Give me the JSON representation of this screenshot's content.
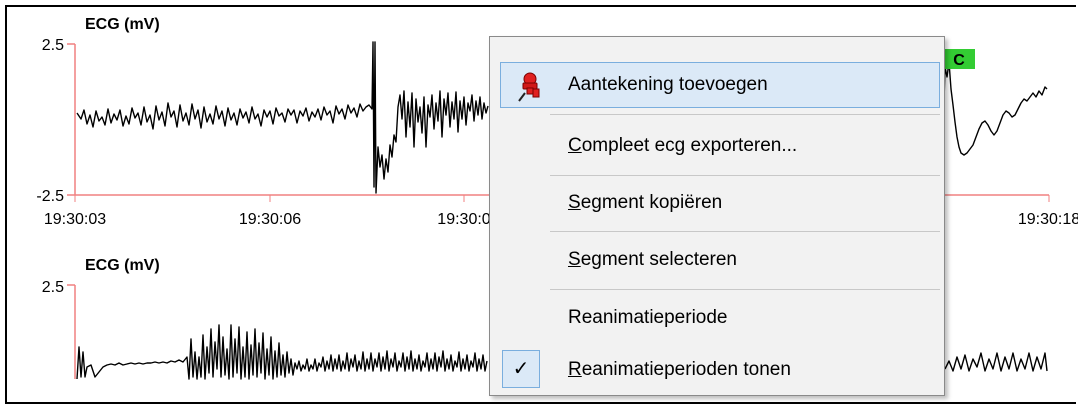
{
  "charts": [
    {
      "ylabel": "ECG (mV)",
      "y_ticks": [
        "2.5",
        "-2.5"
      ],
      "x_ticks": [
        "19:30:03",
        "19:30:06",
        "19:30:0",
        "19:30:18"
      ]
    },
    {
      "ylabel": "ECG (mV)",
      "y_ticks": [
        "2.5"
      ]
    }
  ],
  "marker_label": "C",
  "context_menu": {
    "items": [
      {
        "label": "Aantekening toevoegen",
        "icon": "pushpin-icon",
        "highlighted": true
      },
      {
        "mnemonic": "C",
        "rest": "ompleet ecg exporteren..."
      },
      {
        "mnemonic": "S",
        "rest": "egment kopiëren"
      },
      {
        "mnemonic": "S",
        "rest": "egment selecteren"
      },
      {
        "label": "Reanimatieperiode"
      },
      {
        "mnemonic": "R",
        "rest": "eanimatieperioden tonen",
        "checked": true,
        "check_glyph": "✓"
      }
    ]
  },
  "colors": {
    "axis": "#f08080",
    "trace": "#000000",
    "highlight": "#dbe9f7",
    "marker": "#33cc33"
  }
}
